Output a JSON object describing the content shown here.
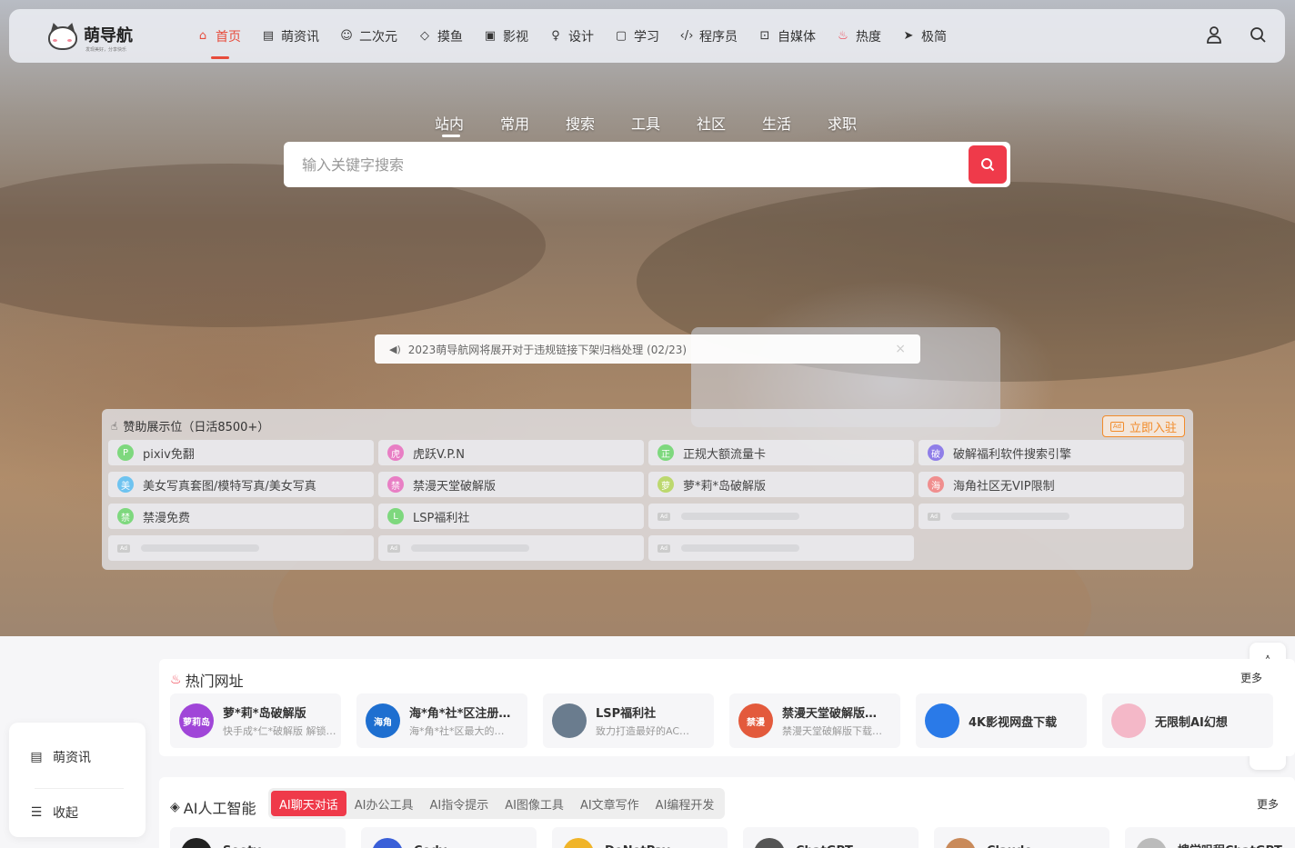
{
  "brand": {
    "name": "萌导航",
    "slogan": "发现美好，分享快乐"
  },
  "nav": {
    "items": [
      {
        "label": "首页",
        "icon": "home-icon"
      },
      {
        "label": "萌资讯",
        "icon": "news-icon"
      },
      {
        "label": "二次元",
        "icon": "face-icon"
      },
      {
        "label": "摸鱼",
        "icon": "tag-icon"
      },
      {
        "label": "影视",
        "icon": "tv-icon"
      },
      {
        "label": "设计",
        "icon": "bulb-icon"
      },
      {
        "label": "学习",
        "icon": "book-icon"
      },
      {
        "label": "程序员",
        "icon": "code-icon"
      },
      {
        "label": "自媒体",
        "icon": "media-icon"
      },
      {
        "label": "热度",
        "icon": "fire-icon"
      },
      {
        "label": "极简",
        "icon": "send-icon"
      }
    ]
  },
  "search": {
    "tabs": [
      "站内",
      "常用",
      "搜索",
      "工具",
      "社区",
      "生活",
      "求职"
    ],
    "active_tab": "站内",
    "placeholder": "输入关键字搜索"
  },
  "notice": {
    "text": "2023萌导航网将展开对于违规链接下架归档处理 (02/23)"
  },
  "sponsor": {
    "title": "赞助展示位（日活8500+）",
    "button": "立即入驻",
    "items": [
      {
        "label": "pixiv免翻",
        "badge": "P",
        "color": "#7ed87e"
      },
      {
        "label": "虎跃V.P.N",
        "badge": "虎",
        "color": "#e87ec4"
      },
      {
        "label": "正规大额流量卡",
        "badge": "正",
        "color": "#7ed87e"
      },
      {
        "label": "破解福利软件搜索引擎",
        "badge": "破",
        "color": "#8f7ee8"
      },
      {
        "label": "美女写真套图/模特写真/美女写真",
        "badge": "美",
        "color": "#6ec3f0"
      },
      {
        "label": "禁漫天堂破解版",
        "badge": "禁",
        "color": "#e87ec4"
      },
      {
        "label": "萝*莉*岛破解版",
        "badge": "萝",
        "color": "#bcd86e"
      },
      {
        "label": "海角社区无VIP限制",
        "badge": "海",
        "color": "#f08e8e"
      },
      {
        "label": "禁漫免费",
        "badge": "禁",
        "color": "#7ed87e"
      },
      {
        "label": "LSP福利社",
        "badge": "L",
        "color": "#7ed87e"
      }
    ],
    "ad_label": "Ad"
  },
  "sidebar": {
    "items": [
      {
        "label": "萌资讯"
      },
      {
        "label": "收起"
      }
    ]
  },
  "hot": {
    "title": "热门网址",
    "more": "更多",
    "cards": [
      {
        "title": "萝*莉*岛破解版",
        "desc": "快手成*仁*破解版 解锁…",
        "avatar_text": "萝莉岛",
        "color": "#a046d8"
      },
      {
        "title": "海*角*社*区注册…",
        "desc": "海*角*社*区最大的…",
        "avatar_text": "海角",
        "color": "#1e6fd0"
      },
      {
        "title": "LSP福利社",
        "desc": "致力打造最好的AC…",
        "avatar_text": "",
        "color": "#6a7c8e"
      },
      {
        "title": "禁漫天堂破解版…",
        "desc": "禁漫天堂破解版下载…",
        "avatar_text": "禁漫",
        "color": "#e35a3c"
      },
      {
        "title": "4K影视网盘下载",
        "desc": "",
        "avatar_text": "",
        "color": "#2a7ae8"
      },
      {
        "title": "无限制AI幻想",
        "desc": "",
        "avatar_text": "",
        "color": "#f4b8c8"
      }
    ]
  },
  "ai": {
    "title": "AI人工智能",
    "more": "更多",
    "tabs": [
      "AI聊天对话",
      "AI办公工具",
      "AI指令提示",
      "AI图像工具",
      "AI文章写作",
      "AI编程开发"
    ],
    "active_tab": "AI聊天对话",
    "cards": [
      "Sooty",
      "Cody",
      "DoNotPay",
      "ChatGPT",
      "Claude",
      "搜学咀程ChatGPT"
    ]
  }
}
